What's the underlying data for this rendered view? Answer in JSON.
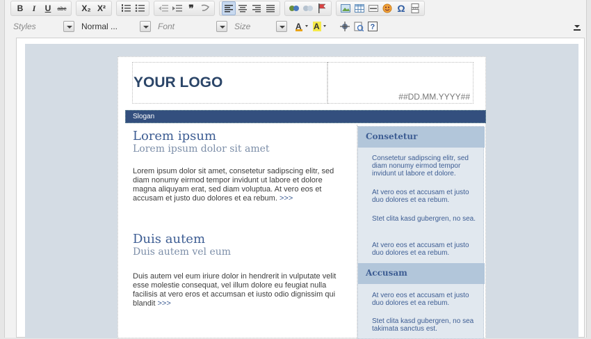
{
  "toolbar": {
    "row1": {
      "bold": "B",
      "italic": "I",
      "underline": "U",
      "strike": "abc",
      "subscript": "X₂",
      "superscript": "X²"
    },
    "combos": {
      "styles": "Styles",
      "format": "Normal ...",
      "font": "Font",
      "size": "Size"
    }
  },
  "document": {
    "logo": "YOUR LOGO",
    "date": "##DD.MM.YYYY##",
    "slogan": "Slogan",
    "articles": [
      {
        "title": "Lorem ipsum",
        "subtitle": "Lorem ipsum dolor sit amet",
        "body": "Lorem ipsum dolor sit amet, consetetur sadipscing elitr, sed diam nonumy eirmod tempor invidunt ut labore et dolore magna aliquyam erat, sed diam voluptua. At vero eos et accusam et justo duo dolores et ea rebum.",
        "more": ">>>"
      },
      {
        "title": "Duis autem",
        "subtitle": "Duis autem vel eum",
        "body": "Duis autem vel eum iriure dolor in hendrerit in vulputate velit esse molestie consequat, vel illum dolore eu feugiat nulla facilisis at vero eros et accumsan et iusto odio dignissim qui blandit",
        "more": ">>>"
      }
    ],
    "sidebar": [
      {
        "heading": "Consetetur",
        "items": [
          "Consetetur sadipscing elitr, sed diam nonumy eirmod tempor invidunt ut labore et dolore.",
          "At vero eos et accusam et justo duo dolores et ea rebum.",
          "Stet clita kasd gubergren, no sea.",
          "At vero eos et accusam et justo duo dolores et ea rebum."
        ]
      },
      {
        "heading": "Accusam",
        "items": [
          "At vero eos et accusam et justo duo dolores et ea rebum.",
          "Stet clita kasd gubergren, no sea takimata sanctus est."
        ]
      }
    ]
  },
  "colors": {
    "brand": "#334f7e",
    "heading": "#3d5d93",
    "sidebar_bg": "#e1e8ef",
    "sidebar_head": "#b2c6da",
    "canvas_bg": "#d4dce4"
  }
}
